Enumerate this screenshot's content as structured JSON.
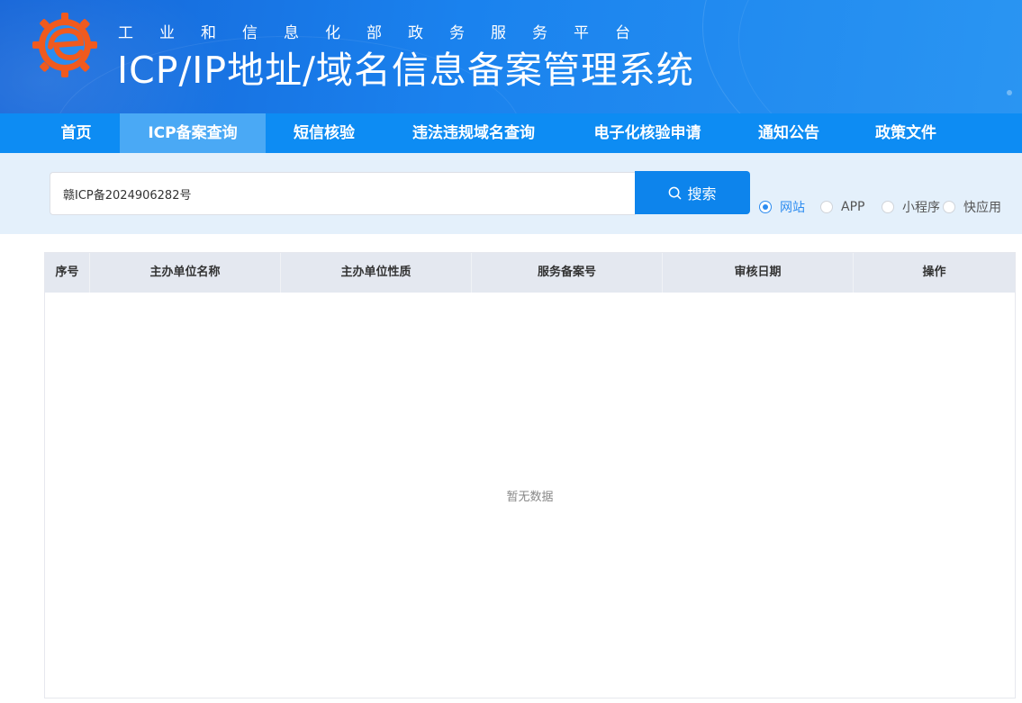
{
  "header": {
    "subtitle": "工业和信息化部政务服务平台",
    "title": "ICP/IP地址/域名信息备案管理系统",
    "logo_icon": "miit-gear-logo-icon",
    "colors": {
      "header_blue": "#1a82ee",
      "logo_orange": "#f05a1e"
    }
  },
  "nav": {
    "items": [
      {
        "label": "首页"
      },
      {
        "label": "ICP备案查询",
        "active": true
      },
      {
        "label": "短信核验"
      },
      {
        "label": "违法违规域名查询"
      },
      {
        "label": "电子化核验申请"
      },
      {
        "label": "通知公告"
      },
      {
        "label": "政策文件"
      }
    ],
    "colors": {
      "bar": "#0d8cf3",
      "active": "#4aa9f5"
    }
  },
  "search": {
    "value": "赣ICP备2024906282号",
    "button_label": "搜索",
    "button_icon": "search-icon",
    "options": [
      {
        "label": "网站",
        "checked": true
      },
      {
        "label": "APP",
        "checked": false
      },
      {
        "label": "小程序",
        "checked": false
      },
      {
        "label": "快应用",
        "checked": false
      }
    ]
  },
  "table": {
    "columns": [
      "序号",
      "主办单位名称",
      "主办单位性质",
      "服务备案号",
      "审核日期",
      "操作"
    ],
    "rows": [],
    "empty_text": "暂无数据"
  }
}
